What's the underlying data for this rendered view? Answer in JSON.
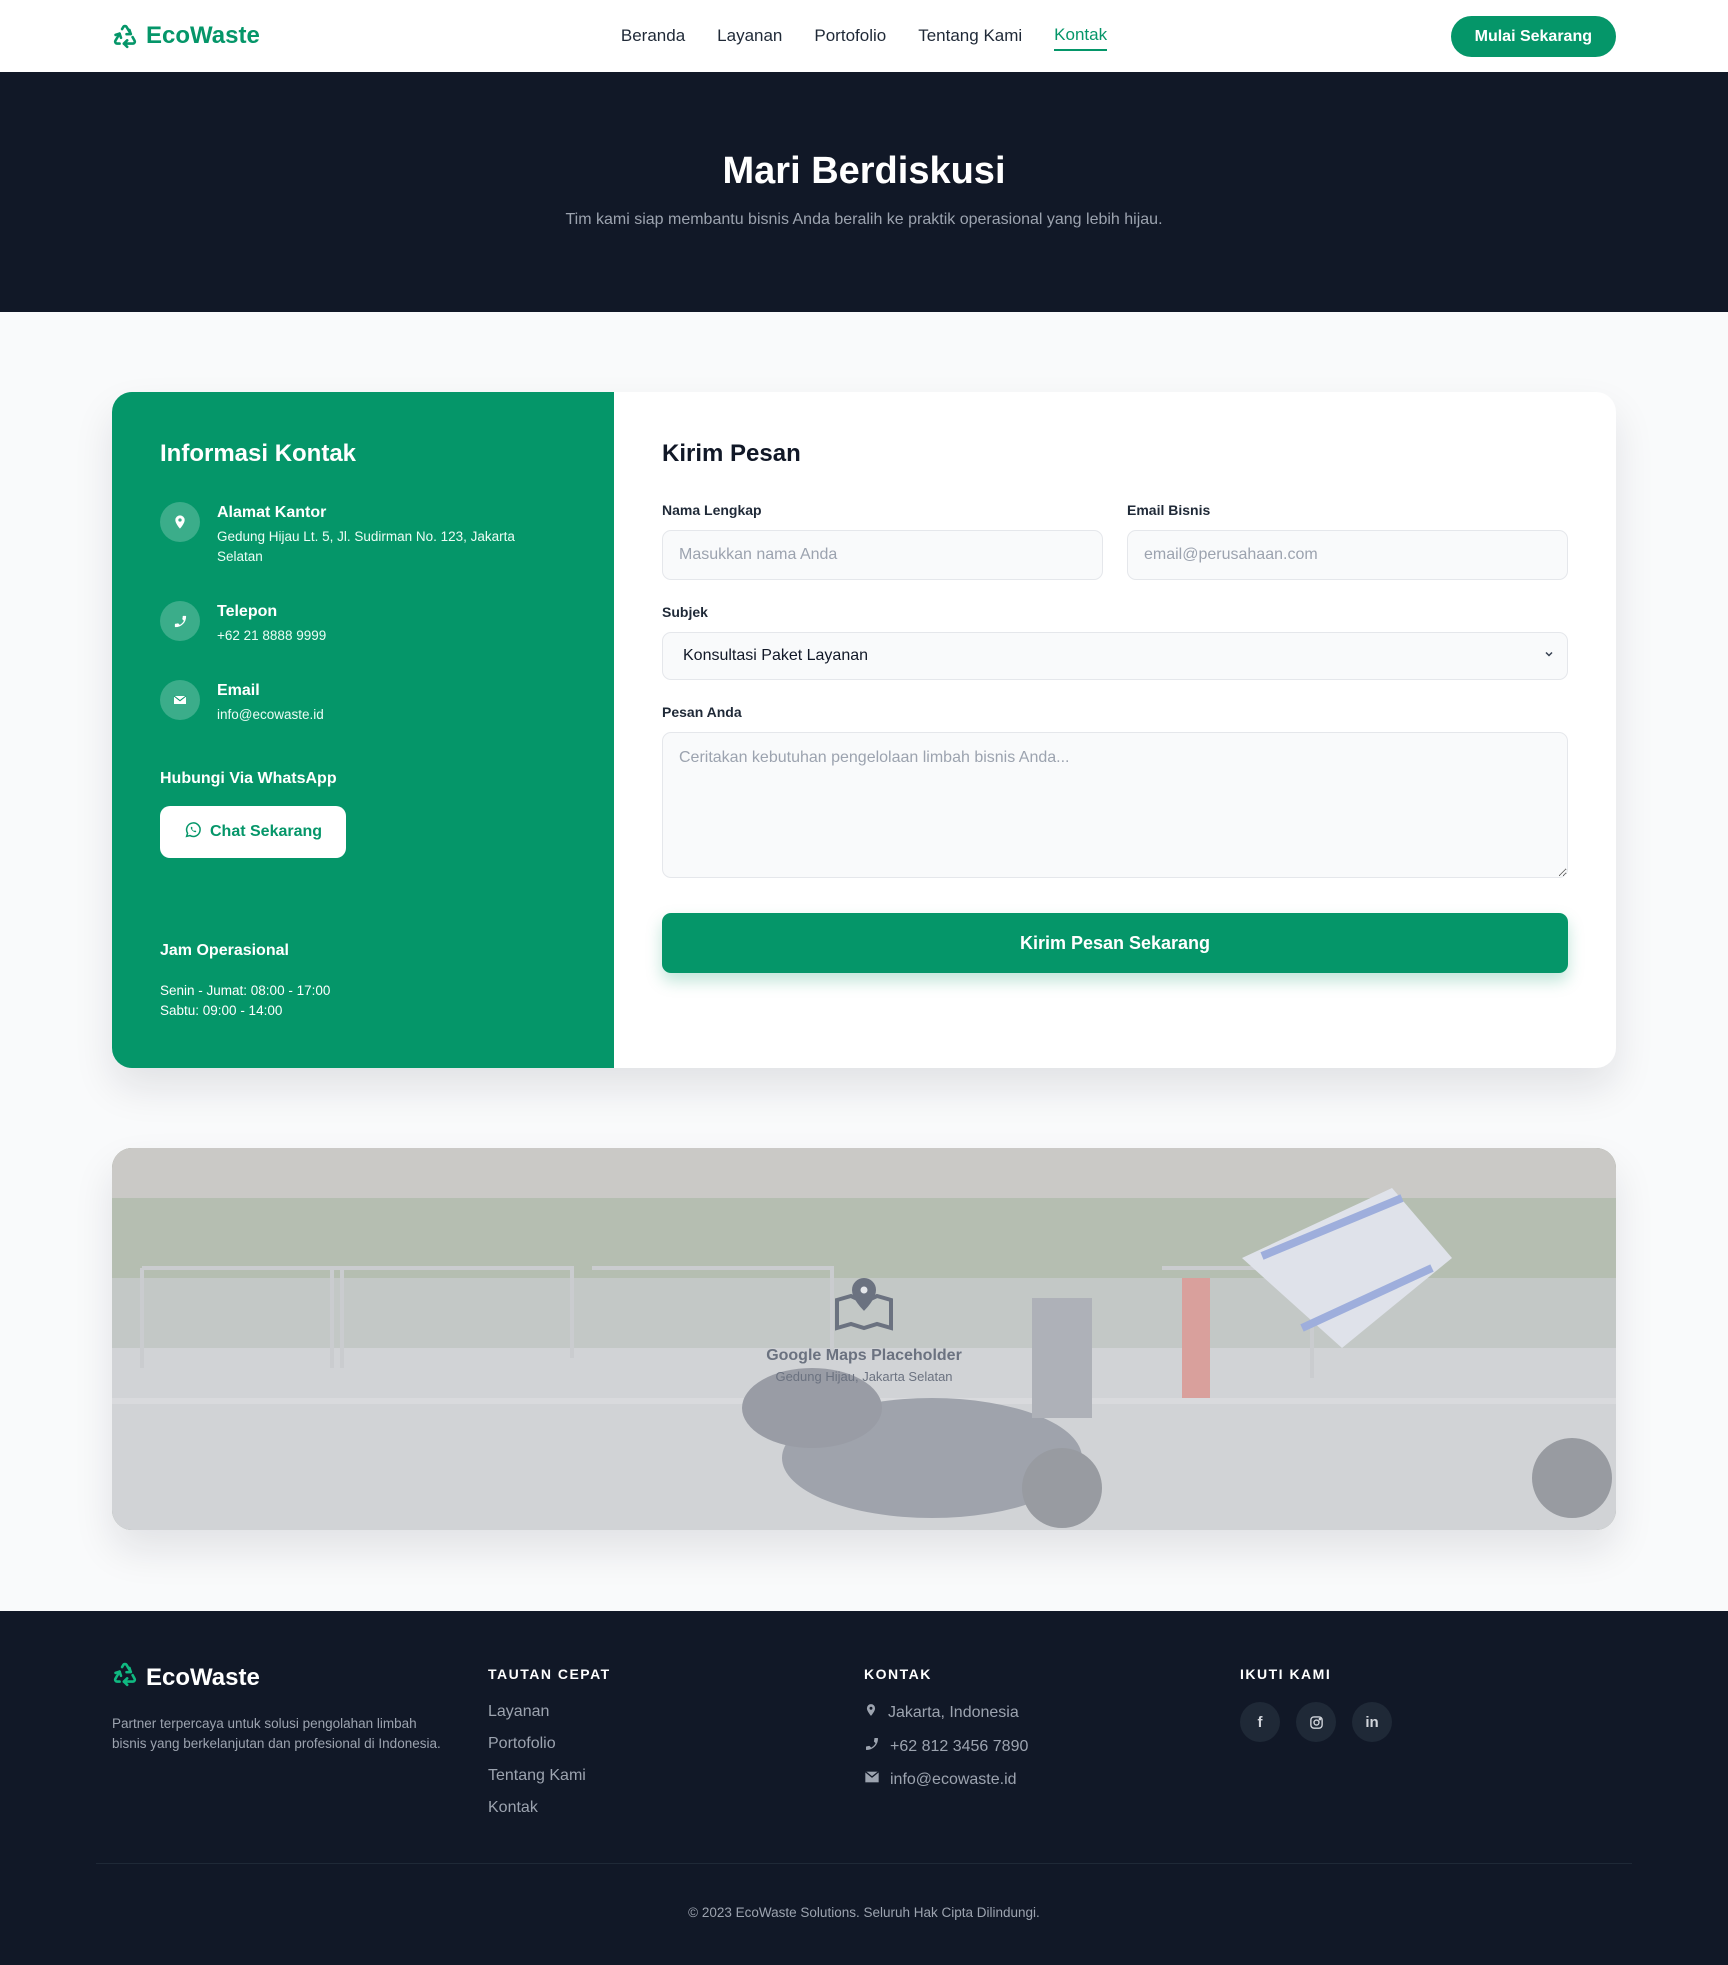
{
  "brand": {
    "name": "EcoWaste",
    "color": "#059669",
    "icon": "recycle-icon"
  },
  "nav": {
    "links": [
      "Beranda",
      "Layanan",
      "Portofolio",
      "Tentang Kami",
      "Kontak"
    ],
    "active": "Kontak",
    "cta": "Mulai Sekarang"
  },
  "hero": {
    "title": "Mari Berdiskusi",
    "subtitle": "Tim kami siap membantu bisnis Anda beralih ke praktik operasional yang lebih hijau."
  },
  "contact_info": {
    "title": "Informasi Kontak",
    "items": [
      {
        "icon": "map-pin-icon",
        "title": "Alamat Kantor",
        "value": "Gedung Hijau Lt. 5, Jl. Sudirman No. 123, Jakarta Selatan"
      },
      {
        "icon": "phone-icon",
        "title": "Telepon",
        "value": "+62 21 8888 9999"
      },
      {
        "icon": "envelope-icon",
        "title": "Email",
        "value": "info@ecowaste.id"
      }
    ],
    "whatsapp_title": "Hubungi Via WhatsApp",
    "whatsapp_button": "Chat Sekarang",
    "hours_title": "Jam Operasional",
    "hours": [
      "Senin - Jumat: 08:00 - 17:00",
      "Sabtu: 09:00 - 14:00"
    ]
  },
  "form": {
    "title": "Kirim Pesan",
    "name_label": "Nama Lengkap",
    "name_placeholder": "Masukkan nama Anda",
    "email_label": "Email Bisnis",
    "email_placeholder": "email@perusahaan.com",
    "subject_label": "Subjek",
    "subject_value": "Konsultasi Paket Layanan",
    "message_label": "Pesan Anda",
    "message_placeholder": "Ceritakan kebutuhan pengelolaan limbah bisnis Anda...",
    "submit": "Kirim Pesan Sekarang"
  },
  "map": {
    "title": "Google Maps Placeholder",
    "subtitle": "Gedung Hijau, Jakarta Selatan"
  },
  "footer": {
    "description": "Partner terpercaya untuk solusi pengolahan limbah bisnis yang berkelanjutan dan profesional di Indonesia.",
    "quick_links_title": "TAUTAN CEPAT",
    "quick_links": [
      "Layanan",
      "Portofolio",
      "Tentang Kami",
      "Kontak"
    ],
    "contact_title": "KONTAK",
    "contact": [
      {
        "icon": "map-pin-icon",
        "text": "Jakarta, Indonesia"
      },
      {
        "icon": "phone-icon",
        "text": "+62 812 3456 7890"
      },
      {
        "icon": "envelope-icon",
        "text": "info@ecowaste.id"
      }
    ],
    "follow_title": "IKUTI KAMI",
    "socials": [
      {
        "icon": "facebook-icon",
        "glyph": "f"
      },
      {
        "icon": "instagram-icon",
        "glyph": ""
      },
      {
        "icon": "linkedin-icon",
        "glyph": "in"
      }
    ],
    "copyright": "© 2023 EcoWaste Solutions. Seluruh Hak Cipta Dilindungi."
  }
}
